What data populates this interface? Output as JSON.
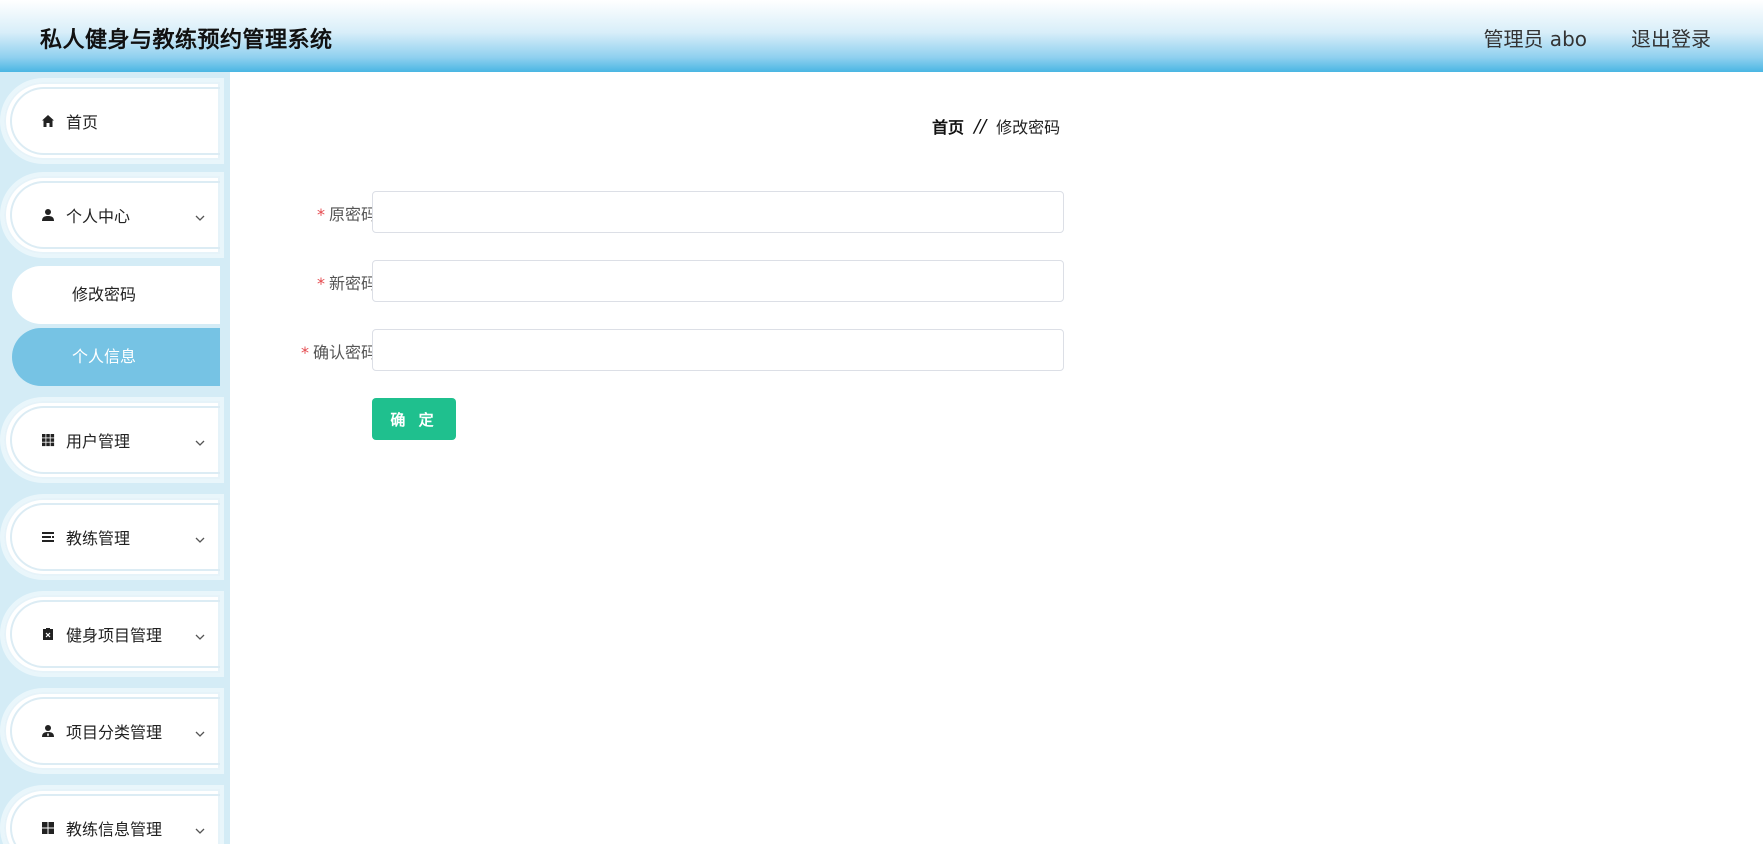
{
  "header": {
    "title": "私人健身与教练预约管理系统",
    "user_label": "管理员 abo",
    "logout_label": "退出登录"
  },
  "sidebar": {
    "items": [
      {
        "label": "首页",
        "icon": "home-icon"
      },
      {
        "label": "个人中心",
        "icon": "user-icon",
        "expanded": true,
        "children": [
          {
            "label": "修改密码",
            "active": false
          },
          {
            "label": "个人信息",
            "active": true
          }
        ]
      },
      {
        "label": "用户管理",
        "icon": "grid-icon"
      },
      {
        "label": "教练管理",
        "icon": "list-icon"
      },
      {
        "label": "健身项目管理",
        "icon": "clipboard-icon"
      },
      {
        "label": "项目分类管理",
        "icon": "user-tie-icon"
      },
      {
        "label": "教练信息管理",
        "icon": "tiles-icon"
      }
    ]
  },
  "breadcrumb": {
    "home": "首页",
    "separator": "//",
    "current": "修改密码"
  },
  "form": {
    "fields": [
      {
        "label": "原密码",
        "required": true,
        "value": ""
      },
      {
        "label": "新密码",
        "required": true,
        "value": ""
      },
      {
        "label": "确认密码",
        "required": true,
        "value": ""
      }
    ],
    "submit_label": "确 定"
  },
  "colors": {
    "header_gradient_end": "#4ab6e3",
    "sidebar_bg": "#d4ecf6",
    "active_submenu": "#76c3e4",
    "submit_button": "#1fc08e",
    "required_star": "#e5484d"
  }
}
